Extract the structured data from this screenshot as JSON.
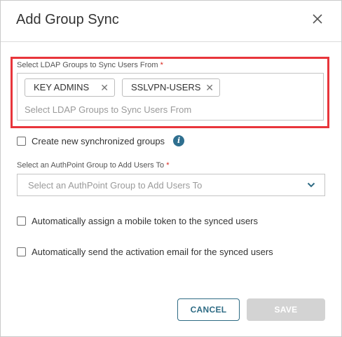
{
  "dialog": {
    "title": "Add Group Sync"
  },
  "ldap_field": {
    "label": "Select LDAP Groups to Sync Users From",
    "required_mark": "*",
    "chips": [
      {
        "label": "KEY ADMINS"
      },
      {
        "label": "SSLVPN-USERS"
      }
    ],
    "placeholder": "Select LDAP Groups to Sync Users From",
    "highlight_color": "#e8353b"
  },
  "create_groups": {
    "label": "Create new synchronized groups",
    "checked": false,
    "info_icon": "info-icon"
  },
  "authpoint_field": {
    "label": "Select an AuthPoint Group to Add Users To",
    "required_mark": "*",
    "placeholder": "Select an AuthPoint Group to Add Users To"
  },
  "options": [
    {
      "label": "Automatically assign a mobile token to the synced users",
      "checked": false
    },
    {
      "label": "Automatically send the activation email for the synced users",
      "checked": false
    }
  ],
  "buttons": {
    "cancel": "CANCEL",
    "save": "SAVE"
  },
  "colors": {
    "primary": "#2e6b84",
    "disabled": "#d3d3d3",
    "required": "#d9241c"
  }
}
